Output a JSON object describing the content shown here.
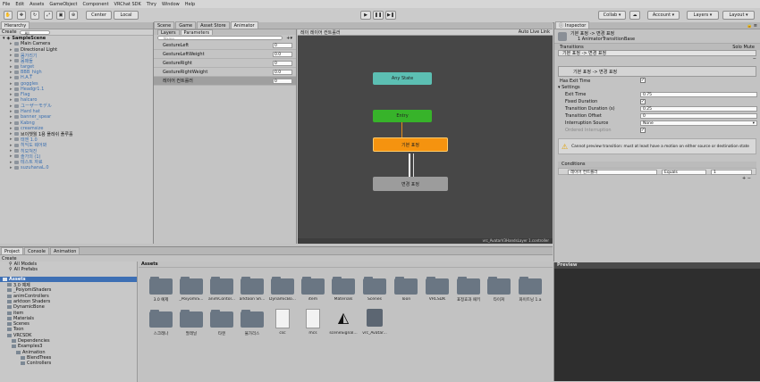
{
  "menu": [
    "File",
    "Edit",
    "Assets",
    "GameObject",
    "Component",
    "VRChat SDK",
    "Thry",
    "Window",
    "Help"
  ],
  "toolbar": {
    "center": "Center",
    "local": "Local",
    "collab": "Collab",
    "account": "Account",
    "layers": "Layers",
    "layout": "Layout"
  },
  "hierarchy": {
    "tab": "Hierarchy",
    "create": "Create",
    "search": "All",
    "scene": "SampleScene",
    "items": [
      {
        "label": "Main Camera",
        "indent": 2,
        "color": "#111"
      },
      {
        "label": "Directional Light",
        "indent": 2,
        "color": "#111"
      },
      {
        "label": "몸가리기",
        "indent": 2,
        "color": "#3a6fb0"
      },
      {
        "label": "몸매들",
        "indent": 2,
        "color": "#3a6fb0"
      },
      {
        "label": "target",
        "indent": 2,
        "color": "#3a6fb0"
      },
      {
        "label": "BBB_high",
        "indent": 2,
        "color": "#3a6fb0"
      },
      {
        "label": "H.A.T",
        "indent": 2,
        "color": "#3a6fb0"
      },
      {
        "label": "goggles",
        "indent": 2,
        "color": "#3a6fb0"
      },
      {
        "label": "Headgr1.1",
        "indent": 2,
        "color": "#3a6fb0"
      },
      {
        "label": "Flag",
        "indent": 2,
        "color": "#3a6fb0"
      },
      {
        "label": "halcaro",
        "indent": 2,
        "color": "#3a6fb0"
      },
      {
        "label": "ユーザーモデル",
        "indent": 2,
        "color": "#3a6fb0"
      },
      {
        "label": "Hard hat",
        "indent": 2,
        "color": "#3a6fb0"
      },
      {
        "label": "banner_spear",
        "indent": 2,
        "color": "#3a6fb0"
      },
      {
        "label": "Kabng",
        "indent": 2,
        "color": "#3a6fb0"
      },
      {
        "label": "creamsize",
        "indent": 2,
        "color": "#3a6fb0"
      },
      {
        "label": "브이챗월 1용 플레쉬 플루홀",
        "indent": 2,
        "color": "#111"
      },
      {
        "label": "태엔 1.0",
        "indent": 2,
        "color": "#3a6fb0"
      },
      {
        "label": "히익도 웨어봐",
        "indent": 2,
        "color": "#3a6fb0"
      },
      {
        "label": "히모쳐진",
        "indent": 2,
        "color": "#3a6fb0"
      },
      {
        "label": "솔가의 (1)",
        "indent": 2,
        "color": "#3a6fb0"
      },
      {
        "label": "테스트 자료",
        "indent": 2,
        "color": "#3a6fb0"
      },
      {
        "label": "suzuhanaL.0",
        "indent": 2,
        "color": "#3a6fb0"
      }
    ]
  },
  "center_tabs": [
    "Scene",
    "Game",
    "Asset Store",
    "Animator"
  ],
  "animator": {
    "sub_tabs": [
      "Layers",
      "Parameters"
    ],
    "search_placeholder": "Name",
    "params": [
      {
        "name": "GestureLeft",
        "value": "0"
      },
      {
        "name": "GestureLeftWeight",
        "value": "0.0"
      },
      {
        "name": "GestureRight",
        "value": "0"
      },
      {
        "name": "GestureRightWeight",
        "value": "0.0"
      },
      {
        "name": "레이어 컨트롤러",
        "value": "0"
      }
    ],
    "breadcrumb": "레이 레이어 컨트롤러",
    "auto_live": "Auto Live Link",
    "nodes": {
      "any": "Any State",
      "entry": "Entry",
      "default": "기본 표정",
      "target": "변경 표정"
    },
    "footer": "vrc_AvatarV3HandsLayer 1.controller"
  },
  "inspector": {
    "tab": "Inspector",
    "title": "기본 표정 -> 변경 표정",
    "subtitle": "1 AnimatorTransitionBase",
    "transitions_label": "Transitions",
    "solo": "Solo",
    "mute": "Mute",
    "transition_item": "기본 표정 -> 변경 표정",
    "sub_transition": "기본 표정 -> 변경 표정",
    "has_exit_time": "Has Exit Time",
    "settings": "Settings",
    "fields": [
      {
        "label": "Exit Time",
        "value": "0.75",
        "type": "text"
      },
      {
        "label": "Fixed Duration",
        "value": "✓",
        "type": "check"
      },
      {
        "label": "Transition Duration (s)",
        "value": "0.25",
        "type": "text"
      },
      {
        "label": "Transition Offset",
        "value": "0",
        "type": "text"
      },
      {
        "label": "Interruption Source",
        "value": "None",
        "type": "select"
      },
      {
        "label": "Ordered Interruption",
        "value": "✓",
        "type": "check"
      }
    ],
    "warning": "Cannot preview transition: must at least have a motion on either source or destination state",
    "conditions": "Conditions",
    "condition": {
      "param": "레이어 컨트롤러",
      "op": "Equals",
      "value": "1"
    }
  },
  "project": {
    "tabs": [
      "Project",
      "Console",
      "Animation"
    ],
    "create": "Create",
    "favorites": [
      "All Models",
      "All Prefabs"
    ],
    "tree": [
      {
        "label": "Assets",
        "indent": 0
      },
      {
        "label": "3.0 예제",
        "indent": 1
      },
      {
        "label": "_PoiyomiShaders",
        "indent": 1
      },
      {
        "label": "animControllers",
        "indent": 1
      },
      {
        "label": "arktoon Shaders",
        "indent": 1
      },
      {
        "label": "DynamicBone",
        "indent": 1
      },
      {
        "label": "item",
        "indent": 1
      },
      {
        "label": "Materials",
        "indent": 1
      },
      {
        "label": "Scenes",
        "indent": 1
      },
      {
        "label": "Toon",
        "indent": 1
      },
      {
        "label": "VRCSDK",
        "indent": 1
      },
      {
        "label": "Dependencies",
        "indent": 2
      },
      {
        "label": "Examples3",
        "indent": 2
      },
      {
        "label": "Animation",
        "indent": 3
      },
      {
        "label": "BlendTrees",
        "indent": 4
      },
      {
        "label": "Controllers",
        "indent": 4
      }
    ],
    "breadcrumb": "Assets",
    "row1": [
      "3.0 예제",
      "_PoiyomiS...",
      "animContol...",
      "arktoon Sh...",
      "DynamicBo...",
      "item",
      "Materials",
      "Scenes",
      "Toon",
      "VRCSDK",
      "표정효과 패키",
      "타이쳐",
      "화이트닝 1.a"
    ],
    "row2": [
      "스크래나",
      "팔래닐",
      "타엔",
      "불가리스",
      "csc",
      "mcs",
      "sceneSignal...",
      "vrc_Avatar..."
    ]
  },
  "preview": "Preview"
}
